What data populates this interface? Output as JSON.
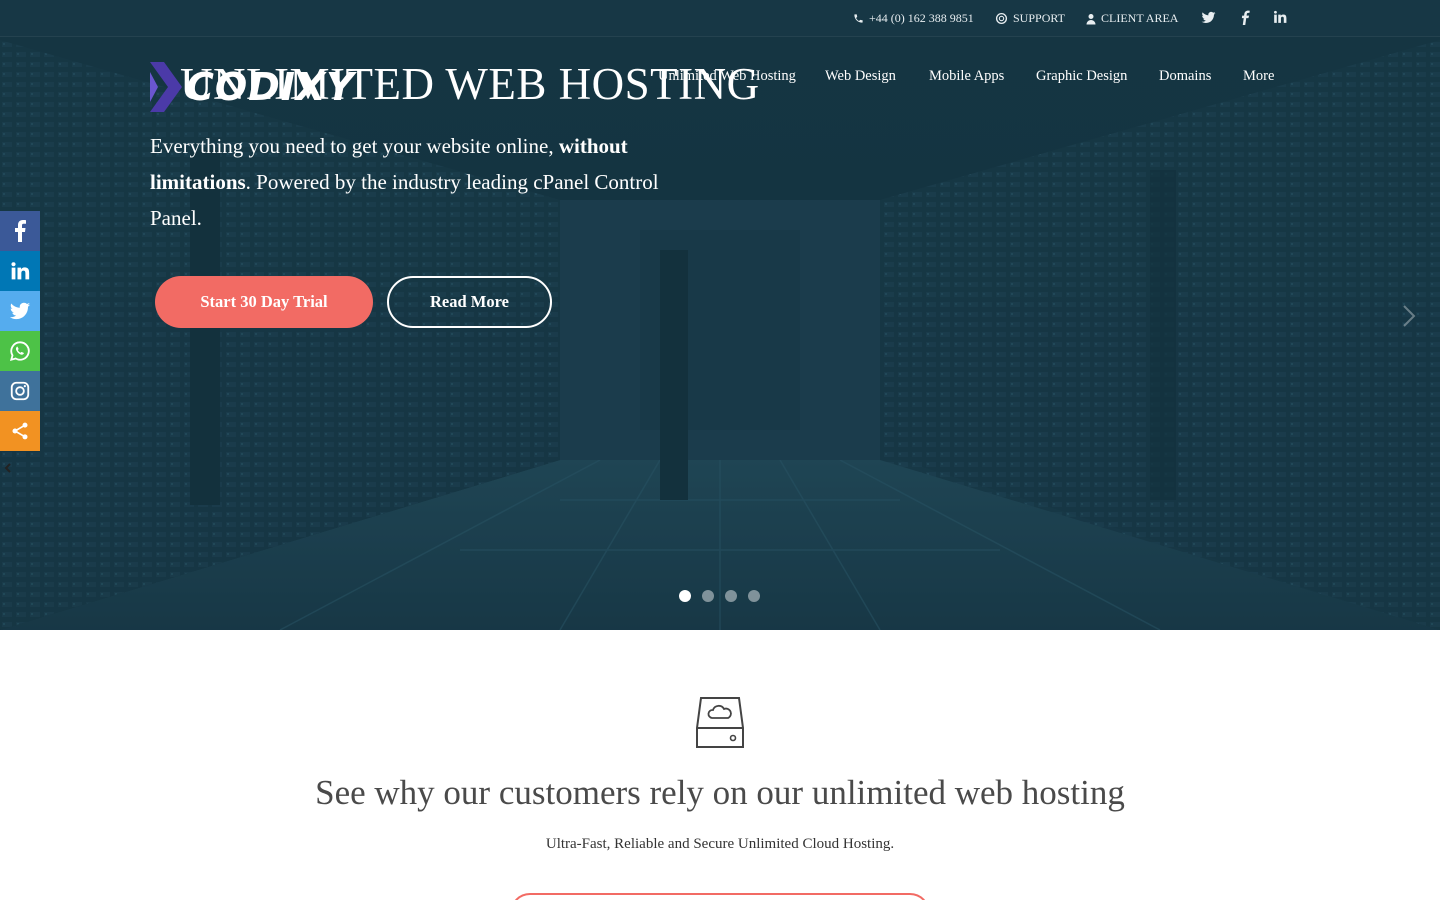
{
  "topbar": {
    "phone": "+44 (0) 162 388 9851",
    "support": "SUPPORT",
    "client_area": "CLIENT AREA",
    "social_icons": [
      "twitter-icon",
      "facebook-icon",
      "linkedin-icon"
    ]
  },
  "logo": {
    "text": "CODIXY"
  },
  "nav": {
    "items": [
      "Unlimited Web Hosting",
      "Web Design",
      "Mobile Apps",
      "Graphic Design",
      "Domains",
      "More"
    ]
  },
  "hero": {
    "title": "UNLIMITED WEB HOSTING",
    "desc_part1": "Everything you need to get your website online,",
    "desc_bold": "without limitations",
    "desc_part2": ". Powered by the industry leading cPanel Control Panel.",
    "primary_button": "Start 30 Day Trial",
    "secondary_button": "Read More",
    "slide_count": 4,
    "active_slide": 1
  },
  "side_share": {
    "buttons": [
      {
        "name": "facebook",
        "color": "#3b5998"
      },
      {
        "name": "linkedin",
        "color": "#0077b5"
      },
      {
        "name": "twitter",
        "color": "#55acee"
      },
      {
        "name": "whatsapp",
        "color": "#4dc247"
      },
      {
        "name": "instagram",
        "color": "#3f729b"
      },
      {
        "name": "share",
        "color": "#f29222"
      }
    ]
  },
  "section": {
    "title": "See why our customers rely on our unlimited web hosting",
    "subtitle": "Ultra-Fast, Reliable and Secure Unlimited Cloud Hosting."
  },
  "colors": {
    "accent": "#f26b64",
    "hero_bg": "#1a3a48",
    "logo_mark": "#4b3aa8"
  }
}
